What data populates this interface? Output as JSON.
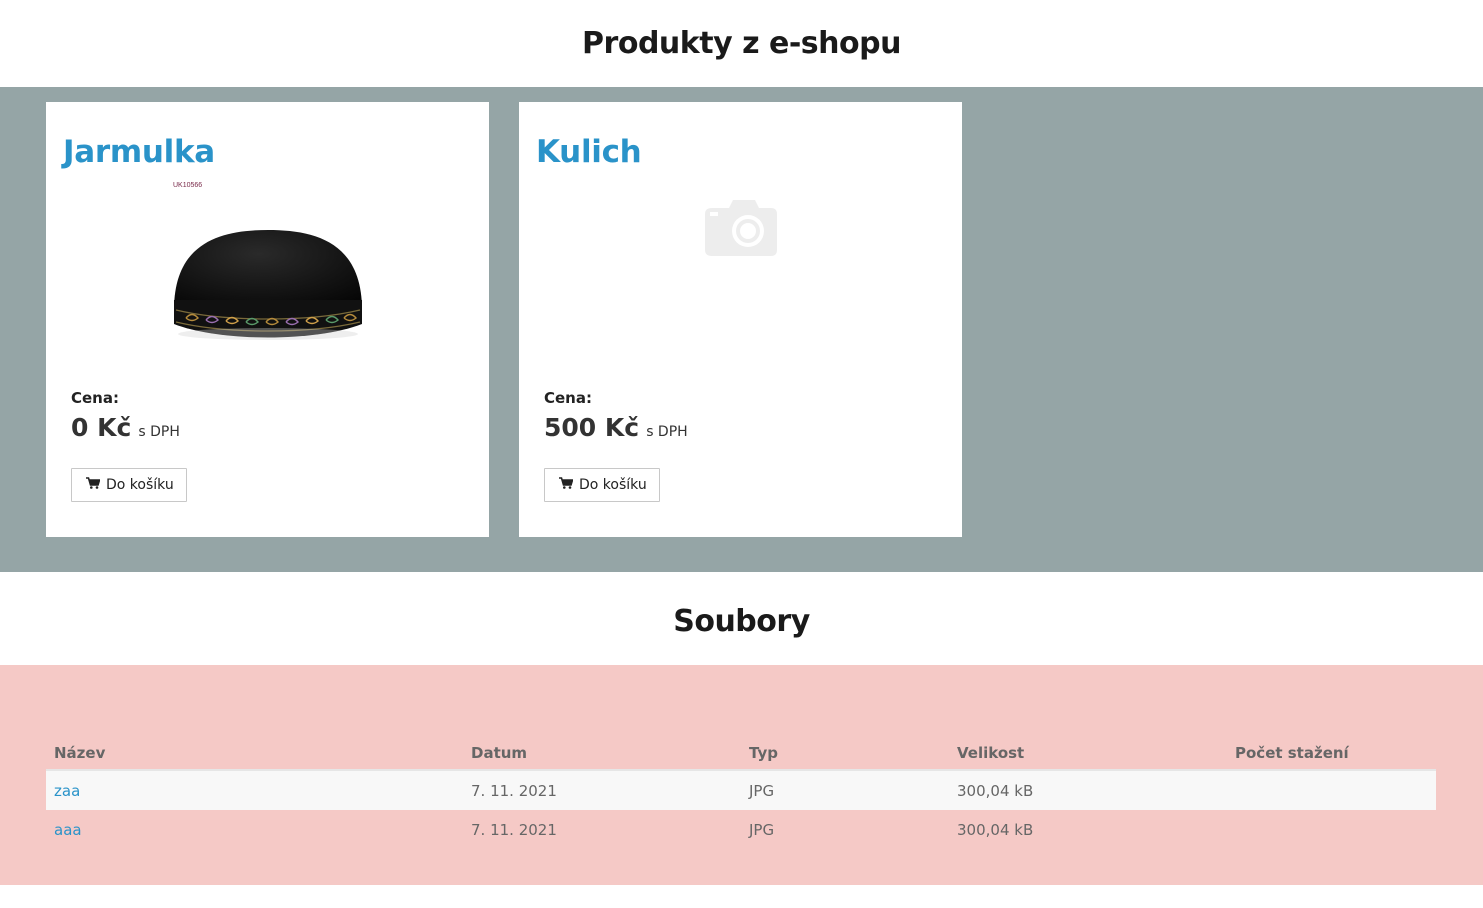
{
  "products_section": {
    "title": "Produkty z e-shopu",
    "items": [
      {
        "name": "Jarmulka",
        "image": "jarmulka-kippah-photo",
        "image_sku_text": "UK10566",
        "price_label": "Cena:",
        "price": "0 Kč",
        "vat_note": "s DPH",
        "cart_label": "Do košíku",
        "cart_icon": "shopping-cart-icon"
      },
      {
        "name": "Kulich",
        "image": "camera-placeholder-icon",
        "price_label": "Cena:",
        "price": "500 Kč",
        "vat_note": "s DPH",
        "cart_label": "Do košíku",
        "cart_icon": "shopping-cart-icon"
      }
    ]
  },
  "files_section": {
    "title": "Soubory",
    "columns": [
      "Název",
      "Datum",
      "Typ",
      "Velikost",
      "Počet stažení"
    ],
    "rows": [
      {
        "name": "zaa",
        "date": "7. 11. 2021",
        "type": "JPG",
        "size": "300,04 kB",
        "downloads": ""
      },
      {
        "name": "aaa",
        "date": "7. 11. 2021",
        "type": "JPG",
        "size": "300,04 kB",
        "downloads": ""
      }
    ]
  },
  "colors": {
    "products_band": "#95a5a6",
    "files_band": "#f5c9c6",
    "link_accent": "#2a93c9"
  }
}
